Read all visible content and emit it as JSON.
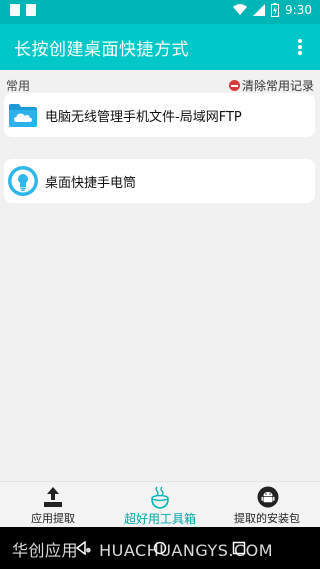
{
  "status_bar": {
    "time": "9:30"
  },
  "app_bar": {
    "title": "长按创建桌面快捷方式"
  },
  "section": {
    "label": "常用",
    "clear_label": "清除常用记录"
  },
  "shortcuts": [
    {
      "label": "电脑无线管理手机文件-局域网FTP",
      "icon": "cloud-folder-icon"
    },
    {
      "label": "桌面快捷手电筒",
      "icon": "lightbulb-icon"
    }
  ],
  "bottom_nav": [
    {
      "label": "应用提取",
      "icon": "upload-icon",
      "active": false
    },
    {
      "label": "超好用工具箱",
      "icon": "toolbox-icon",
      "active": true
    },
    {
      "label": "提取的安装包",
      "icon": "android-icon",
      "active": false
    }
  ],
  "watermark": "华创应用 • HUACHUANGYS.COM",
  "colors": {
    "primary": "#00c8c8",
    "status_bar": "#00b5b5",
    "accent_active": "#00a7a7",
    "stop_red": "#d83b3b"
  }
}
